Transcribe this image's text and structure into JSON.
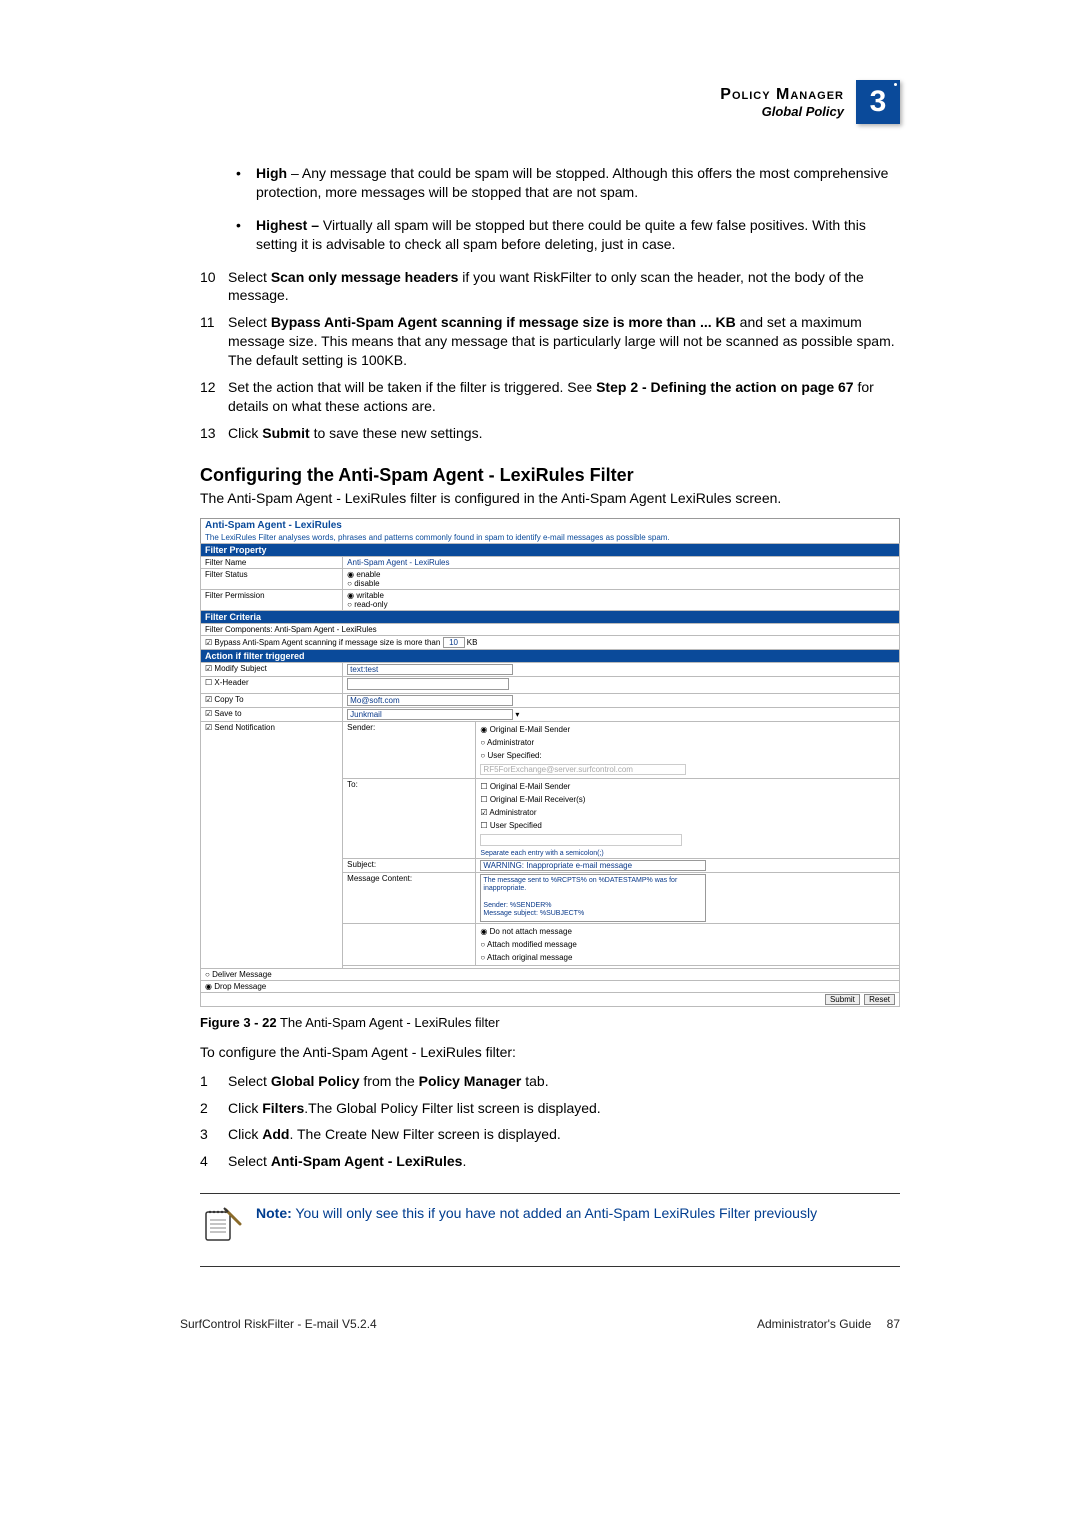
{
  "header": {
    "title": "Policy Manager",
    "subtitle": "Global Policy",
    "chapter": "3"
  },
  "bullets": [
    {
      "lead": "High",
      "text": " – Any message that could be spam will be stopped. Although this offers the most comprehensive protection, more messages will be stopped that are not spam."
    },
    {
      "lead": "Highest –",
      "text": " Virtually all spam will be stopped but there could be quite a few false positives. With this setting it is advisable to check all spam before deleting, just in case."
    }
  ],
  "steps_a": [
    {
      "n": "10",
      "pre": "Select ",
      "bold": "Scan only message headers",
      "post": " if you want RiskFilter to only scan the header, not the body of the message."
    },
    {
      "n": "11",
      "pre": "Select ",
      "bold": "Bypass Anti-Spam Agent scanning if message size is more than ... KB",
      "post": " and set a maximum message size. This means that any message that is particularly large will not be scanned as possible spam. The default setting is 100KB."
    },
    {
      "n": "12",
      "pre": "Set the action that will be taken if the filter is triggered. See ",
      "bold": "Step 2 - Defining the action on page 67",
      "post": " for details on what these actions are."
    },
    {
      "n": "13",
      "pre": "Click ",
      "bold": "Submit",
      "post": " to save these new settings."
    }
  ],
  "section_title": "Configuring the Anti-Spam Agent - LexiRules Filter",
  "section_intro": "The Anti-Spam Agent - LexiRules filter is configured in the Anti-Spam Agent LexiRules screen.",
  "screenshot": {
    "title": "Anti-Spam Agent - LexiRules",
    "desc": "The LexiRules Filter analyses words, phrases and patterns commonly found in spam to identify e-mail messages as possible spam.",
    "sec_property": "Filter Property",
    "filter_name_label": "Filter Name",
    "filter_name_value": "Anti-Spam Agent - LexiRules",
    "filter_status_label": "Filter Status",
    "status_enable": "enable",
    "status_disable": "disable",
    "filter_perm_label": "Filter Permission",
    "perm_writable": "writable",
    "perm_readonly": "read-only",
    "sec_criteria": "Filter Criteria",
    "criteria_components": "Filter Components: Anti-Spam Agent - LexiRules",
    "criteria_bypass_pre": "Bypass Anti-Spam Agent scanning if message size is more than",
    "criteria_bypass_value": "10",
    "criteria_bypass_unit": "KB",
    "sec_action": "Action if filter triggered",
    "modify_subject_label": "Modify Subject",
    "modify_subject_value": "text:test",
    "x_header_label": "X-Header",
    "copy_to_label": "Copy To",
    "copy_to_value": "Mo@soft.com",
    "save_to_label": "Save to",
    "save_to_value": "Junkmail",
    "send_notif_label": "Send Notification",
    "sender_label": "Sender:",
    "sender_original": "Original E-Mail Sender",
    "sender_admin": "Administrator",
    "sender_user": "User Specified:",
    "sender_user_value": "RF5ForExchange@server.surfcontrol.com",
    "to_label": "To:",
    "to_original_sender": "Original E-Mail Sender",
    "to_original_receiver": "Original E-Mail Receiver(s)",
    "to_admin": "Administrator",
    "to_user": "User Specified",
    "separate_note": "Separate each entry with a semicolon(;)",
    "subject_label": "Subject:",
    "subject_value": "WARNING: Inappropriate e-mail message",
    "msg_content_label": "Message Content:",
    "msg_content_value": "The message sent to %RCPTS% on %DATESTAMP% was for inappropriate.\n\nSender: %SENDER%\nMessage subject: %SUBJECT%",
    "attach_none": "Do not attach message",
    "attach_modified": "Attach modified message",
    "attach_original": "Attach original message",
    "deliver_label": "Deliver Message",
    "drop_label": "Drop Message",
    "btn_submit": "Submit",
    "btn_reset": "Reset"
  },
  "figure_caption_bold": "Figure 3 - 22",
  "figure_caption_rest": " The Anti-Spam Agent - LexiRules filter",
  "config_intro": "To configure the Anti-Spam Agent - LexiRules filter:",
  "steps_b": [
    {
      "n": "1",
      "parts": [
        "Select ",
        "Global Policy",
        " from the ",
        "Policy Manager",
        " tab."
      ]
    },
    {
      "n": "2",
      "parts": [
        "Click ",
        "Filters",
        ".The Global Policy Filter list screen is displayed."
      ]
    },
    {
      "n": "3",
      "parts": [
        "Click ",
        "Add",
        ". The Create New Filter screen is displayed."
      ]
    },
    {
      "n": "4",
      "parts": [
        "Select ",
        "Anti-Spam Agent - LexiRules",
        "."
      ]
    }
  ],
  "note_label": "Note:",
  "note_body": "You will only see this if you have not added an Anti-Spam LexiRules Filter previously",
  "footer": {
    "product": "SurfControl RiskFilter - E-mail V5.2.4",
    "guide": "Administrator's Guide",
    "page": "87"
  }
}
